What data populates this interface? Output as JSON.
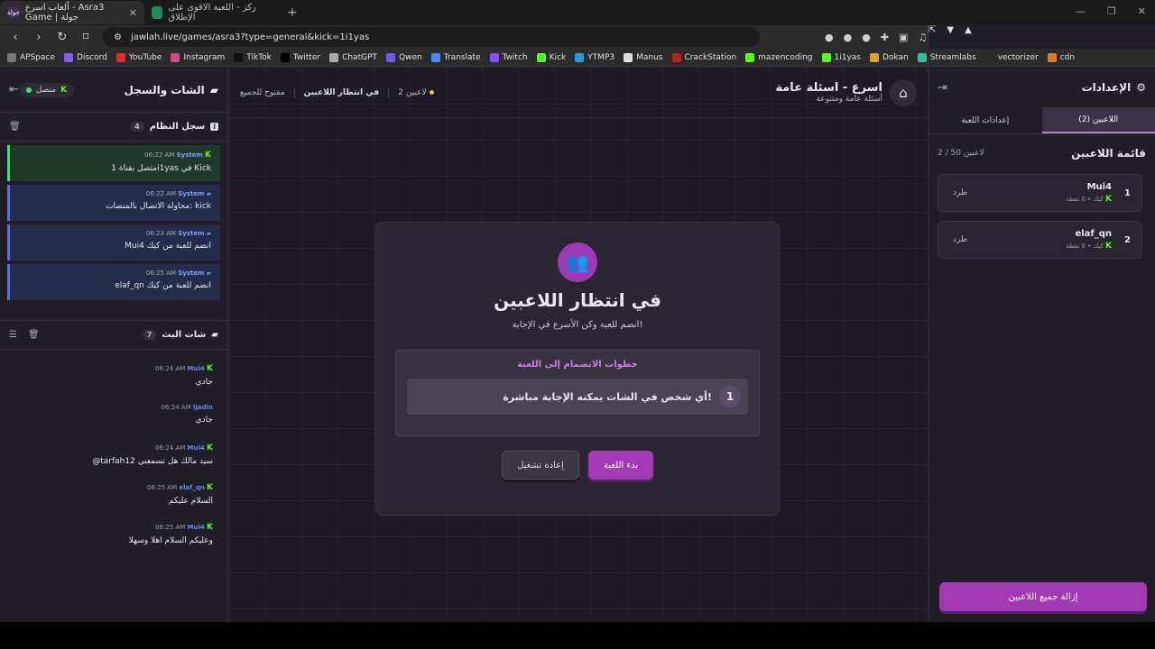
{
  "browser": {
    "tabs": [
      {
        "label": "ألعاب اسرع - Asra3 Game | جولة",
        "fav": "جولة"
      },
      {
        "label": "ركز - اللعبة الاقوى على الإطلاق"
      }
    ],
    "url": "jawlah.live/games/asra3?type=general&kick=1i1yas",
    "bookmarks": [
      "APSpace",
      "Discord",
      "YouTube",
      "Instagram",
      "TikTok",
      "Twitter",
      "ChatGPT",
      "Qwen",
      "Translate",
      "Twitch",
      "Kick",
      "YTMP3",
      "Manus",
      "CrackStation",
      "mazencoding",
      "1i1yas",
      "Dokan",
      "Streamlabs",
      "vectorizer",
      "cdn"
    ]
  },
  "left": {
    "title": "الشات والسجل",
    "online": "متصل",
    "syslog": {
      "title": "سجل النظام",
      "count": "4",
      "messages": [
        {
          "user": "System",
          "time": "06:22 AM",
          "text": "متصل بقناة 1i1yas في Kick",
          "style": "green"
        },
        {
          "user": "System",
          "time": "06:22 AM",
          "text": "محاولة الاتصال بالمنصات: kick",
          "style": "blue"
        },
        {
          "user": "System",
          "time": "06:23 AM",
          "text": "Mui4 انضم للعبة من كيك",
          "style": "blue"
        },
        {
          "user": "System",
          "time": "06:25 AM",
          "text": "elaf_qn انضم للعبة من كيك",
          "style": "blue"
        }
      ]
    },
    "chat": {
      "title": "شات البث",
      "count": "7",
      "messages": [
        {
          "user": "Mui4",
          "time": "06:24 AM",
          "text": "جادي"
        },
        {
          "user": "Ijadin",
          "time": "06:24 AM",
          "text": "جادي"
        },
        {
          "user": "Mui4",
          "time": "06:24 AM",
          "text": "@tarfah12 سيد مالك هل تسمعني"
        },
        {
          "user": "elaf_qn",
          "time": "06:25 AM",
          "text": "السلام عليكم"
        },
        {
          "user": "Mui4",
          "time": "06:25 AM",
          "text": "وعليكم السلام اهلا وسهلا"
        }
      ]
    }
  },
  "center": {
    "status_players": "2 لاعبين",
    "status_wait": "في انتظار اللاعبين",
    "status_open": "مفتوح للجميع",
    "title": "اسرع - اسئلة عامة",
    "subtitle": "أسئلة عامة ومتنوعة",
    "card": {
      "heading": "في انتظار اللاعبين",
      "sub": "انضم للعبة وكن الأسرع في الإجابة!",
      "steps_title": "خطوات الانضمام إلى اللعبة",
      "step_num": "1",
      "step_text": "أي شخص في الشات يمكنه الإجابة مباشرة!",
      "start": "بدء اللعبة",
      "restart": "إعادة تشغيل"
    }
  },
  "right": {
    "title": "الإعدادات",
    "tab_players": "اللاعبين (2)",
    "tab_settings": "إعدادات اللعبة",
    "list_title": "قائمة اللاعبين",
    "list_count": "2 / 50 لاعبين",
    "players": [
      {
        "idx": "1",
        "name": "Mui4",
        "pts": "كيك • 0 نقطة",
        "kick": "طرد"
      },
      {
        "idx": "2",
        "name": "elaf_qn",
        "pts": "كيك • 0 نقطة",
        "kick": "طرد"
      }
    ],
    "clear": "إزالة جميع اللاعبين"
  }
}
